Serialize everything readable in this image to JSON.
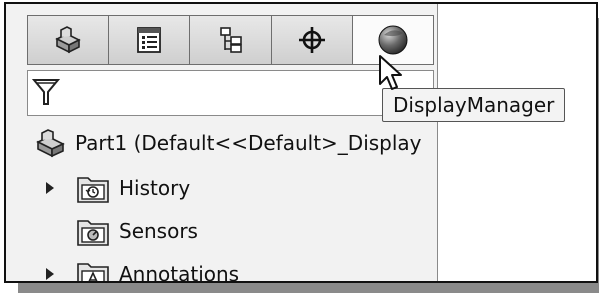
{
  "tabs": [
    {
      "icon": "part-icon"
    },
    {
      "icon": "property-manager-icon"
    },
    {
      "icon": "configuration-manager-icon"
    },
    {
      "icon": "dimxpert-manager-icon"
    },
    {
      "icon": "display-manager-icon"
    }
  ],
  "filter": {
    "icon": "filter-icon"
  },
  "tooltip": {
    "text": "DisplayManager"
  },
  "tree": {
    "root": {
      "label": "Part1  (Default<<Default>_Display"
    },
    "items": [
      {
        "label": "History",
        "expandable": true,
        "icon": "history-folder-icon"
      },
      {
        "label": "Sensors",
        "expandable": false,
        "icon": "sensors-folder-icon"
      },
      {
        "label": "Annotations",
        "expandable": true,
        "icon": "annotations-folder-icon"
      }
    ]
  }
}
